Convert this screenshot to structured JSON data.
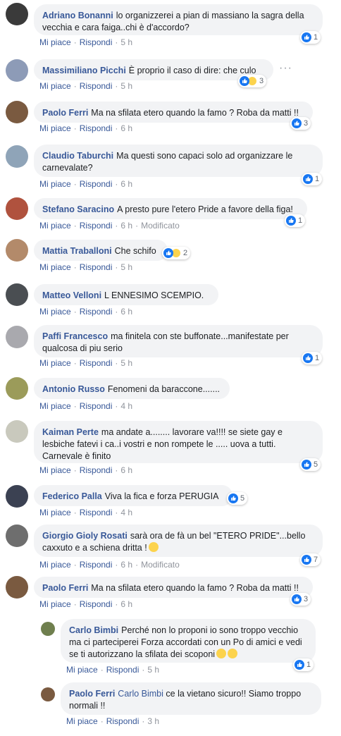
{
  "labels": {
    "like": "Mi piace",
    "reply": "Rispondi",
    "modified": "Modificato"
  },
  "comments": [
    {
      "author": "Adriano Bonanni",
      "text": "lo organizzerei a pian di massiano la sagra della vecchia e cara faiga..chi è d'accordo?",
      "time": "5 h",
      "reactions": "1"
    },
    {
      "author": "Massimiliano Picchi",
      "text": "È proprio il caso di dire: che culo",
      "time": "5 h",
      "reactions": "3"
    },
    {
      "author": "Paolo Ferri",
      "text": "Ma na sfilata etero quando la famo ? Roba da matti !!",
      "time": "6 h",
      "reactions": "3"
    },
    {
      "author": "Claudio Taburchi",
      "text": "Ma questi sono capaci solo ad organizzare le carnevalate?",
      "time": "6 h",
      "reactions": "1"
    },
    {
      "author": "Stefano Saracino",
      "text": "A presto pure l'etero Pride a favore della figa!",
      "time": "6 h",
      "reactions": "1"
    },
    {
      "author": "Mattia Traballoni",
      "text": "Che schifo",
      "time": "5 h",
      "reactions": "2"
    },
    {
      "author": "Matteo Velloni",
      "text": "L ENNESIMO SCEMPIO.",
      "time": "6 h",
      "reactions": ""
    },
    {
      "author": "Paffi Francesco",
      "text": "ma finitela con ste buffonate...manifestate per qualcosa di piu serio",
      "time": "5 h",
      "reactions": "1"
    },
    {
      "author": "Antonio Russo",
      "text": "Fenomeni da baraccone.......",
      "time": "4 h",
      "reactions": ""
    },
    {
      "author": "Kaiman Perte",
      "text": "ma andate a........ lavorare va!!!! se siete gay e lesbiche fatevi i ca..i vostri e non rompete le ..... uova a tutti. Carnevale è finito",
      "time": "6 h",
      "reactions": "5"
    },
    {
      "author": "Federico Palla",
      "text": "Viva la fica e forza PERUGIA",
      "time": "4 h",
      "reactions": "5"
    },
    {
      "author": "Giorgio Gioly Rosati",
      "text": "sarà ora de fà un bel \"ETERO PRIDE\"...bello caxxuto e a schiena dritta !",
      "time": "6 h",
      "reactions": "7"
    },
    {
      "author": "Paolo Ferri",
      "text": "Ma na sfilata etero quando la famo ? Roba da matti !!",
      "time": "6 h",
      "reactions": "3"
    },
    {
      "author": "Carlo Bimbi",
      "text": "Perché non lo proponi io sono troppo vecchio ma ci parteciperei Forza accordati con un Po di amici e vedi se ti autorizzano la sfilata dei scoponi",
      "time": "5 h",
      "reactions": "1"
    },
    {
      "author": "Paolo Ferri",
      "mention": "Carlo Bimbi",
      "text": "ce la vietano sicuro!! Siamo troppo normali !!",
      "time": "3 h",
      "reactions": ""
    }
  ]
}
